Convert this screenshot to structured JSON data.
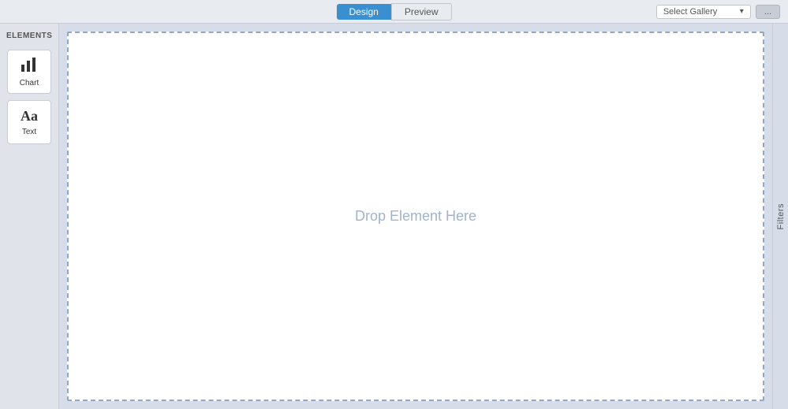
{
  "topbar": {
    "design_tab": "Design",
    "preview_tab": "Preview",
    "gallery_placeholder": "Select Gallery",
    "action_btn": "..."
  },
  "sidebar": {
    "section_label": "ELEMENTS",
    "items": [
      {
        "id": "chart",
        "label": "Chart",
        "icon": "chart"
      },
      {
        "id": "text",
        "label": "Text",
        "icon": "text"
      }
    ]
  },
  "canvas": {
    "drop_hint": "Drop Element Here"
  },
  "filters_tab": {
    "label": "Filters"
  },
  "right_panel": {
    "collapse_arrow": "❯"
  }
}
